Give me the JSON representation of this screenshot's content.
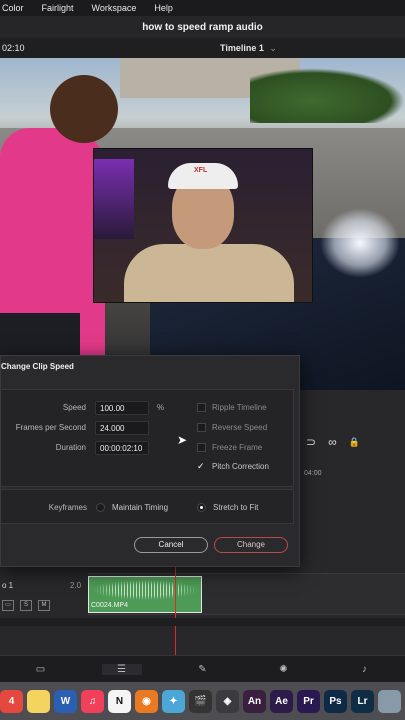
{
  "menubar": {
    "items": [
      "Color",
      "Fairlight",
      "Workspace",
      "Help"
    ]
  },
  "window": {
    "title": "how to speed ramp audio"
  },
  "viewer": {
    "timecode": "02:10",
    "timeline_name": "Timeline 1",
    "timeline_chevron": "⌄",
    "webcam_logo": "XFL"
  },
  "dialog": {
    "title": "Change Clip Speed",
    "speed_label": "Speed",
    "speed_value": "100.00",
    "speed_unit": "%",
    "fps_label": "Frames per Second",
    "fps_value": "24.000",
    "duration_label": "Duration",
    "duration_value": "00:00:02:10",
    "ripple_label": "Ripple Timeline",
    "reverse_label": "Reverse Speed",
    "freeze_label": "Freeze Frame",
    "pitch_label": "Pitch Correction",
    "pitch_checked": true,
    "keyframes_label": "Keyframes",
    "maintain_label": "Maintain Timing",
    "stretch_label": "Stretch to Fit",
    "keyframe_mode": "stretch",
    "cancel_label": "Cancel",
    "change_label": "Change"
  },
  "timeline": {
    "ruler_tc": "04:00",
    "track_name": "o 1",
    "track_num": "2.0",
    "btn_s": "S",
    "btn_m": "M",
    "clip_name": "C0024.MP4"
  },
  "icons": {
    "magnet": "⊃",
    "link": "∞",
    "lock": "🔒",
    "pages": [
      "▭",
      "☰",
      "✎",
      "✺",
      "♪"
    ]
  },
  "dock": [
    {
      "name": "calendar-icon",
      "label": "4",
      "color": "#e5483e"
    },
    {
      "name": "notes-icon",
      "label": "",
      "color": "#f4d35e"
    },
    {
      "name": "word-icon",
      "label": "W",
      "color": "#2b5fb4"
    },
    {
      "name": "music-icon",
      "label": "♫",
      "color": "#f2405a"
    },
    {
      "name": "notion-icon",
      "label": "N",
      "color": "#f5f5f5"
    },
    {
      "name": "blender-icon",
      "label": "◉",
      "color": "#e97a22"
    },
    {
      "name": "color-app-icon",
      "label": "✦",
      "color": "#4aa7d6"
    },
    {
      "name": "clapper-icon",
      "label": "🎬",
      "color": "#333333"
    },
    {
      "name": "resolve-icon",
      "label": "◈",
      "color": "#3a3a3f"
    },
    {
      "name": "animate-icon",
      "label": "An",
      "color": "#3b1f3e"
    },
    {
      "name": "after-effects-icon",
      "label": "Ae",
      "color": "#2d1b4a"
    },
    {
      "name": "premiere-icon",
      "label": "Pr",
      "color": "#2a1850"
    },
    {
      "name": "photoshop-icon",
      "label": "Ps",
      "color": "#0f2a47"
    },
    {
      "name": "lightroom-icon",
      "label": "Lr",
      "color": "#0f2d44"
    },
    {
      "name": "extra-icon",
      "label": "",
      "color": "#8899aa"
    }
  ]
}
